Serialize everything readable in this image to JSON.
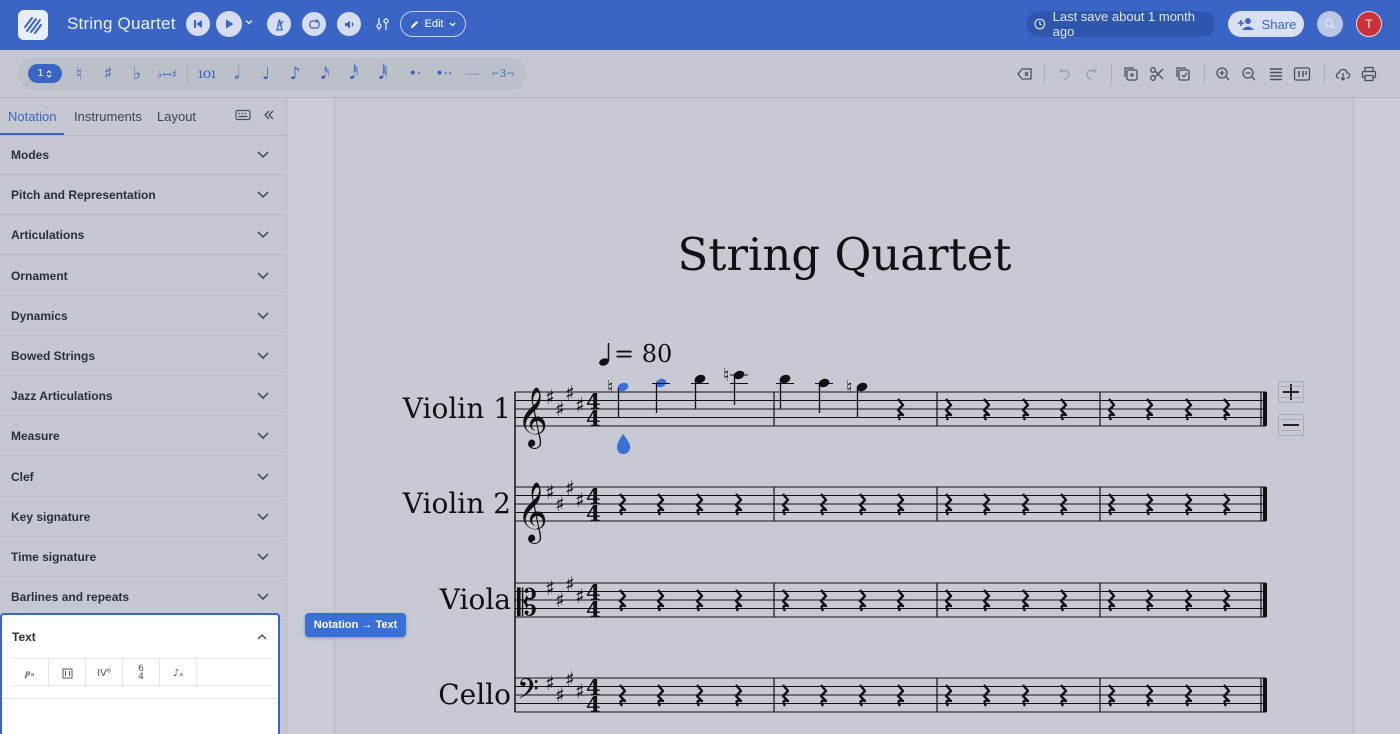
{
  "app": {
    "title": "String Quartet",
    "save_status": "Last save about 1 month ago",
    "share_label": "Share",
    "edit_label": "Edit",
    "avatar_initial": "T"
  },
  "toolbar": {
    "voice_number": "1",
    "duration_symbols": [
      "𝅝",
      "𝅗𝅥",
      "♩",
      "♪",
      "𝅘𝅥𝅯",
      "𝅘𝅥𝅰",
      "𝅘𝅥𝅱"
    ]
  },
  "sidebar": {
    "tabs": [
      "Notation",
      "Instruments",
      "Layout"
    ],
    "active_tab": "Notation",
    "categories": [
      "Modes",
      "Pitch and Representation",
      "Articulations",
      "Ornament",
      "Dynamics",
      "Bowed Strings",
      "Jazz Articulations",
      "Measure",
      "Clef",
      "Key signature",
      "Time signature",
      "Barlines and repeats"
    ],
    "expanded": {
      "label": "Text"
    }
  },
  "tooltip": "Notation → Text",
  "score": {
    "title": "String Quartet",
    "tempo": "= 80",
    "instruments": [
      "Violin 1",
      "Violin 2",
      "Viola",
      "Cello"
    ]
  },
  "colors": {
    "accent": "#3b65c4",
    "header": "#3b65c4",
    "selected_note": "#3b6fd8"
  }
}
